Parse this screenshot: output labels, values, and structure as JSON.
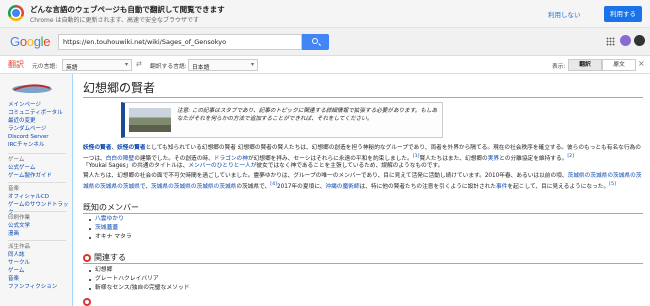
{
  "promo": {
    "title": "どんな言語のウェブページも自動で翻訳して閲覧できます",
    "subtitle": "Chrome は自動的に更新されます、高速で安全なブラウザです",
    "no_label": "利用しない",
    "yes_label": "利用する"
  },
  "google": {
    "logo_letters": [
      "G",
      "o",
      "o",
      "g",
      "l",
      "e"
    ],
    "url": "https://en.touhouwiki.net/wiki/Sages_of_Gensokyo"
  },
  "translate_bar": {
    "brand": "翻訳",
    "source_label": "元の言語:",
    "source_value": "英語",
    "target_label": "翻訳する言語:",
    "target_value": "日本語",
    "view_label": "表示:",
    "translated_label": "翻訳",
    "original_label": "原文"
  },
  "sidebar": {
    "main": [
      "メインページ",
      "コミュニティポータル",
      "最近の変更",
      "ランダムページ",
      "Discord Server",
      "IRCチャンネル"
    ],
    "game_heading": "ゲーム",
    "game": [
      "公式ゲーム",
      "ゲーム製作ガイド"
    ],
    "music_heading": "音楽",
    "music": [
      "オフィシャルCD",
      "ゲームのサウンドトラック"
    ],
    "print_heading": "印刷作業",
    "print": [
      "公式文学",
      "漫画"
    ],
    "fan_heading": "派生作品",
    "fan": [
      "同人誌",
      "サークル",
      "ゲーム",
      "音楽",
      "ファンフィクション"
    ]
  },
  "article": {
    "title": "幻想郷の賢者",
    "notice": "注意: この記事はスタブであり、記事のトピックに関連する詳細情報で拡張する必要があります。もしあなたがそれを何らかの方法で追加することができれば、それをしてください。",
    "para1_a": "妖怪の賢者",
    "para1_b": "、",
    "para1_c": "妖怪の賢者",
    "para1_d": "としても知られている幻想郷の賢者 幻想郷の賢者の賢人たちは、幻想郷の創造を担う神秘的なグループであり、両者を外界から隔てる。現在の社会秩序を確立する。彼らのもっとも有名な行為の一つは、",
    "para1_e": "白白の障壁",
    "para1_f": "の建築でした。その創造の時、",
    "para1_g": "ドラゴンの神",
    "para1_h": "が幻想郷を拝み、セーシはそれらに永遠の平和を約束しました。",
    "para1_i": "[1]",
    "para1_j": "賢人たちはまた、幻想郷の",
    "para1_k": "実界",
    "para1_l": "との分離協定を維持する。",
    "para1_m": "[2]",
    "para2_a": "「Youkai Sages」の共通のタイトルは、",
    "para2_b": "メンバーのひとりと一人が",
    "para2_c": "彼女ではなく神であることを主張しているため、誤解のようなものです。",
    "para3_a": "賢人たちは、幻想郷の社会の面で不可欠時間を過ごしていました。霊夢ゆかりは、グループの唯一のメンバーであり、目に見えて活発に活動し続けています。2010年春、あるいは以前の頃、",
    "para3_b": "茨城県の茨城県の茨城県の茨城県の茨城県の茨城県で",
    "para3_c": "、",
    "para3_d": "茨城県の茨城県の茨城県の茨城県",
    "para3_e": "の茨城県で、",
    "para3_f": "[4]",
    "para3_g": "2017年の夏頃に、",
    "para3_h": "沖縄の魔術師",
    "para3_i": "は、特に他の賢者たちの注意を引くように設計された",
    "para3_j": "事件",
    "para3_k": "を起こして、目に見えるようになった。",
    "para3_l": "[5]",
    "known_heading": "既知のメンバー",
    "known": [
      {
        "text": "八雲ゆかり",
        "link": true
      },
      {
        "text": "茨城蓋蓋",
        "link": true
      },
      {
        "text": "オキナ マタラ",
        "link": false
      }
    ],
    "related_heading": "関連する",
    "related": [
      "幻想郷",
      "グレートハクレイバリア",
      "斬様なセンス/独自の完璧なメソッド"
    ]
  }
}
